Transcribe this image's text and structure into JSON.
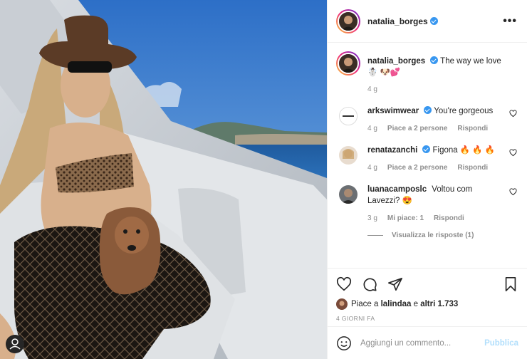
{
  "post": {
    "author": "natalia_borges",
    "caption": "The way we love",
    "caption_emoji": "☃️ 🐶💕",
    "caption_time": "4 g"
  },
  "comments": [
    {
      "user": "arkswimwear",
      "verified": true,
      "text": "You're gorgeous",
      "time": "4 g",
      "likes": "Piace a 2 persone",
      "reply": "Rispondi"
    },
    {
      "user": "renatazanchi",
      "verified": true,
      "text": "Figona 🔥 🔥 🔥",
      "time": "4 g",
      "likes": "Piace a 2 persone",
      "reply": "Rispondi"
    },
    {
      "user": "luanacamposlc",
      "verified": false,
      "text": "Voltou com Lavezzi? 😍",
      "time": "3 g",
      "likes": "Mi piace: 1",
      "reply": "Rispondi"
    }
  ],
  "view_replies": "Visualizza le risposte (1)",
  "liked_by": {
    "prefix": "Piace a",
    "user": "lalindaa",
    "middle": "e",
    "others": "altri 1.733"
  },
  "post_date": "4 GIORNI FA",
  "add_comment": {
    "placeholder": "Aggiungi un commento...",
    "publish": "Pubblica"
  },
  "icons": [
    "heart-icon",
    "comment-icon",
    "share-icon",
    "bookmark-icon",
    "emoji-icon",
    "more-icon"
  ],
  "colors": {
    "verified": "#3897f0",
    "publish": "#b2dffc",
    "muted": "#8e8e8e",
    "text": "#262626"
  }
}
